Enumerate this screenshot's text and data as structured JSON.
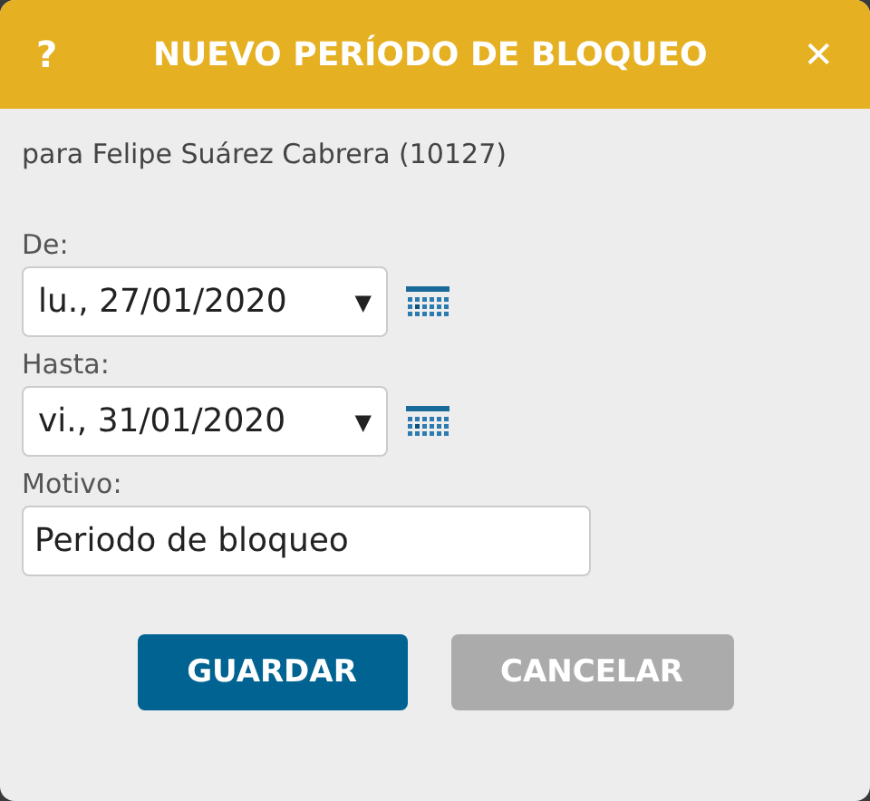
{
  "dialog": {
    "title": "NUEVO PERÍODO DE BLOQUEO",
    "help": "?",
    "close": "✕"
  },
  "subtitle": "para Felipe Suárez Cabrera (10127)",
  "fields": [
    {
      "kind": "date",
      "label": "De:",
      "value": "lu., 27/01/2020",
      "caret": "▼"
    },
    {
      "kind": "date",
      "label": "Hasta:",
      "value": "vi., 31/01/2020",
      "caret": "▼"
    },
    {
      "kind": "text",
      "label": "Motivo:",
      "value": "Periodo de bloqueo"
    }
  ],
  "buttons": [
    {
      "kind": "primary",
      "label": "GUARDAR"
    },
    {
      "kind": "secondary",
      "label": "CANCELAR"
    }
  ]
}
